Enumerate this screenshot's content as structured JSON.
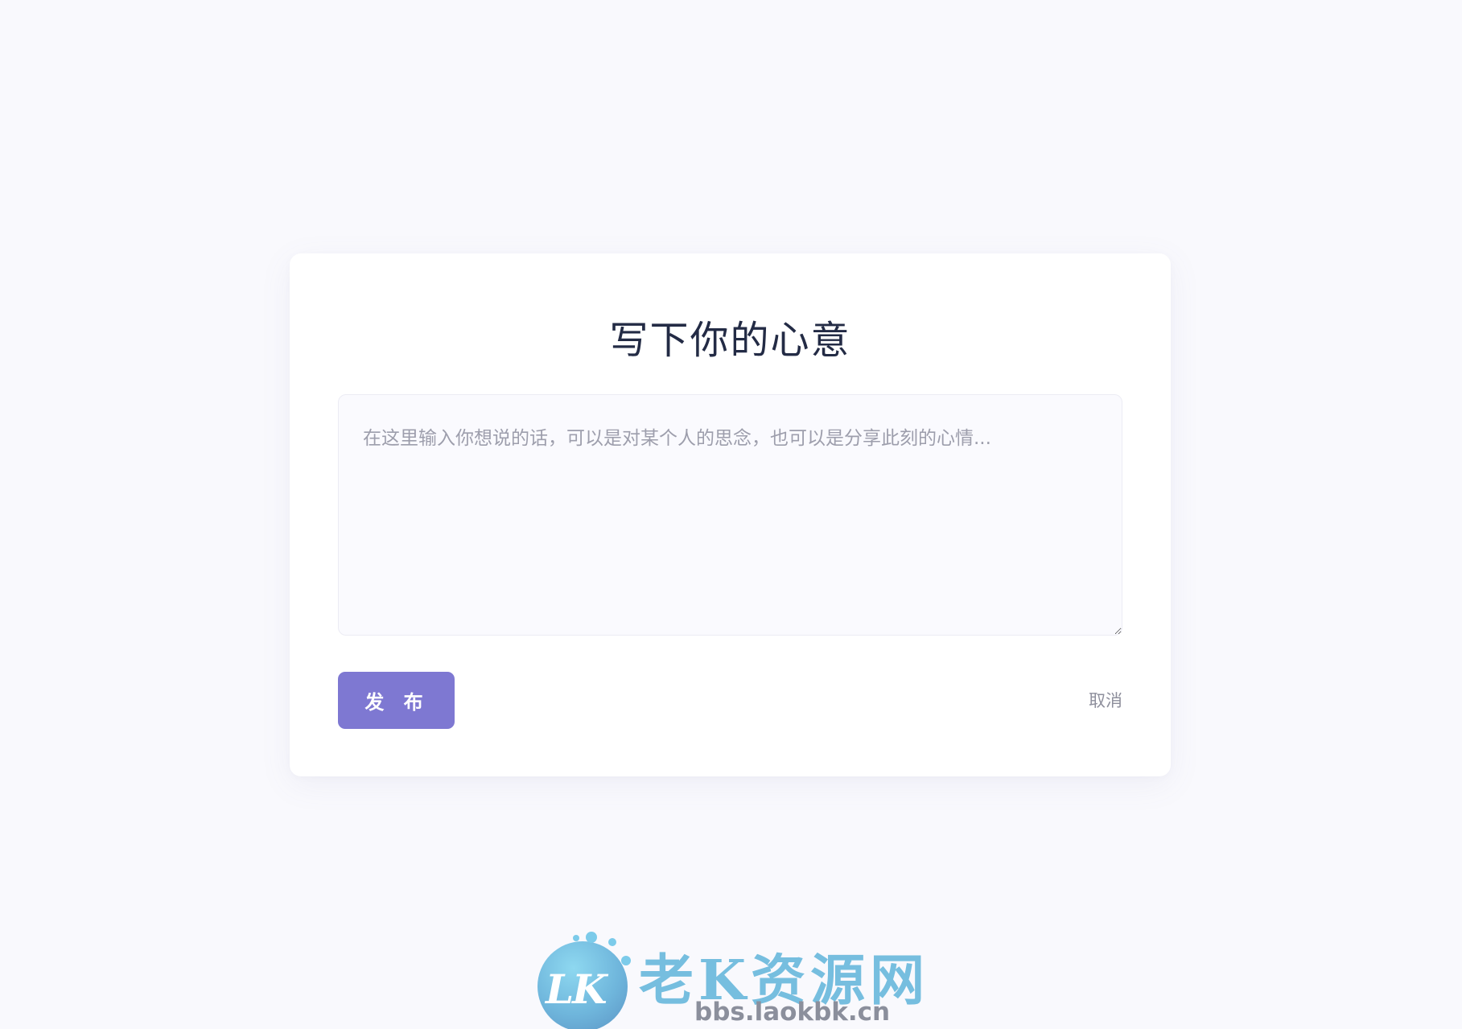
{
  "card": {
    "title": "写下你的心意",
    "message_placeholder": "在这里输入你想说的话，可以是对某个人的思念，也可以是分享此刻的心情...",
    "message_value": "",
    "publish_label": "发 布",
    "cancel_label": "取消"
  },
  "watermark": {
    "logo_text": "LK",
    "site_name": "老K资源网",
    "site_url": "bbs.laokbk.cn"
  },
  "colors": {
    "background": "#f9f9fd",
    "accent": "#7e78d2",
    "title_text": "#232b45",
    "muted_text": "#9d9eac",
    "watermark_blue": "#76bedf"
  }
}
